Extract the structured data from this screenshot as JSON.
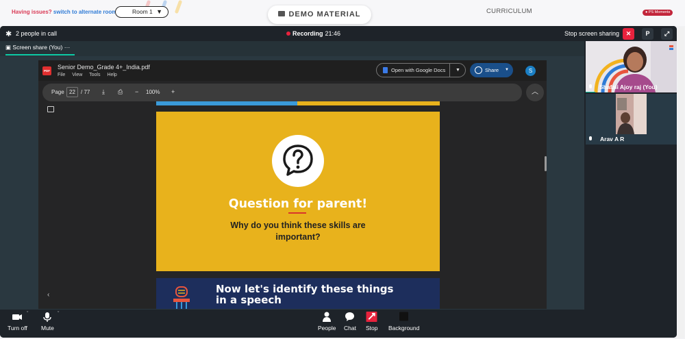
{
  "topbar": {
    "issue_text": "Having issues?",
    "alt_link": "switch to alternate room",
    "room_value": "Room 1",
    "demo_material": "DEMO MATERIAL",
    "curriculum": "CURRICULUM",
    "moments": "PS Moments"
  },
  "call": {
    "people_count": "2 people in call",
    "recording_label": "Recording",
    "recording_time": "21:46",
    "stop_sharing": "Stop screen sharing",
    "p_badge": "P",
    "tab_label": "Screen share (You)",
    "tab_more": "···"
  },
  "pdf": {
    "badge": "PDF",
    "filename": "Senior Demo_Grade 4+_India.pdf",
    "menu": [
      "File",
      "View",
      "Tools",
      "Help"
    ],
    "open_with": "Open with Google Docs",
    "share": "Share",
    "avatar_letter": "S",
    "page_label": "Page",
    "page_current": "22",
    "page_total": "/ 77",
    "zoom": "100%"
  },
  "slide1": {
    "title": "Question for parent!",
    "body": "Why do you think these skills are important?"
  },
  "slide2": {
    "title_line1": "Now let's identify these things",
    "title_line2": "in a speech"
  },
  "participants": [
    {
      "name": "Shafali Ajoy raj (You)"
    },
    {
      "name": "Arav A R"
    }
  ],
  "controls": {
    "turn_off": "Turn off",
    "mute": "Mute",
    "people": "People",
    "chat": "Chat",
    "stop": "Stop",
    "background": "Background"
  },
  "colors": {
    "slide_yellow": "#e8b21c",
    "slide_navy": "#1d2e5c",
    "accent_teal": "#0ccba6",
    "recording_red": "#e8223d"
  }
}
